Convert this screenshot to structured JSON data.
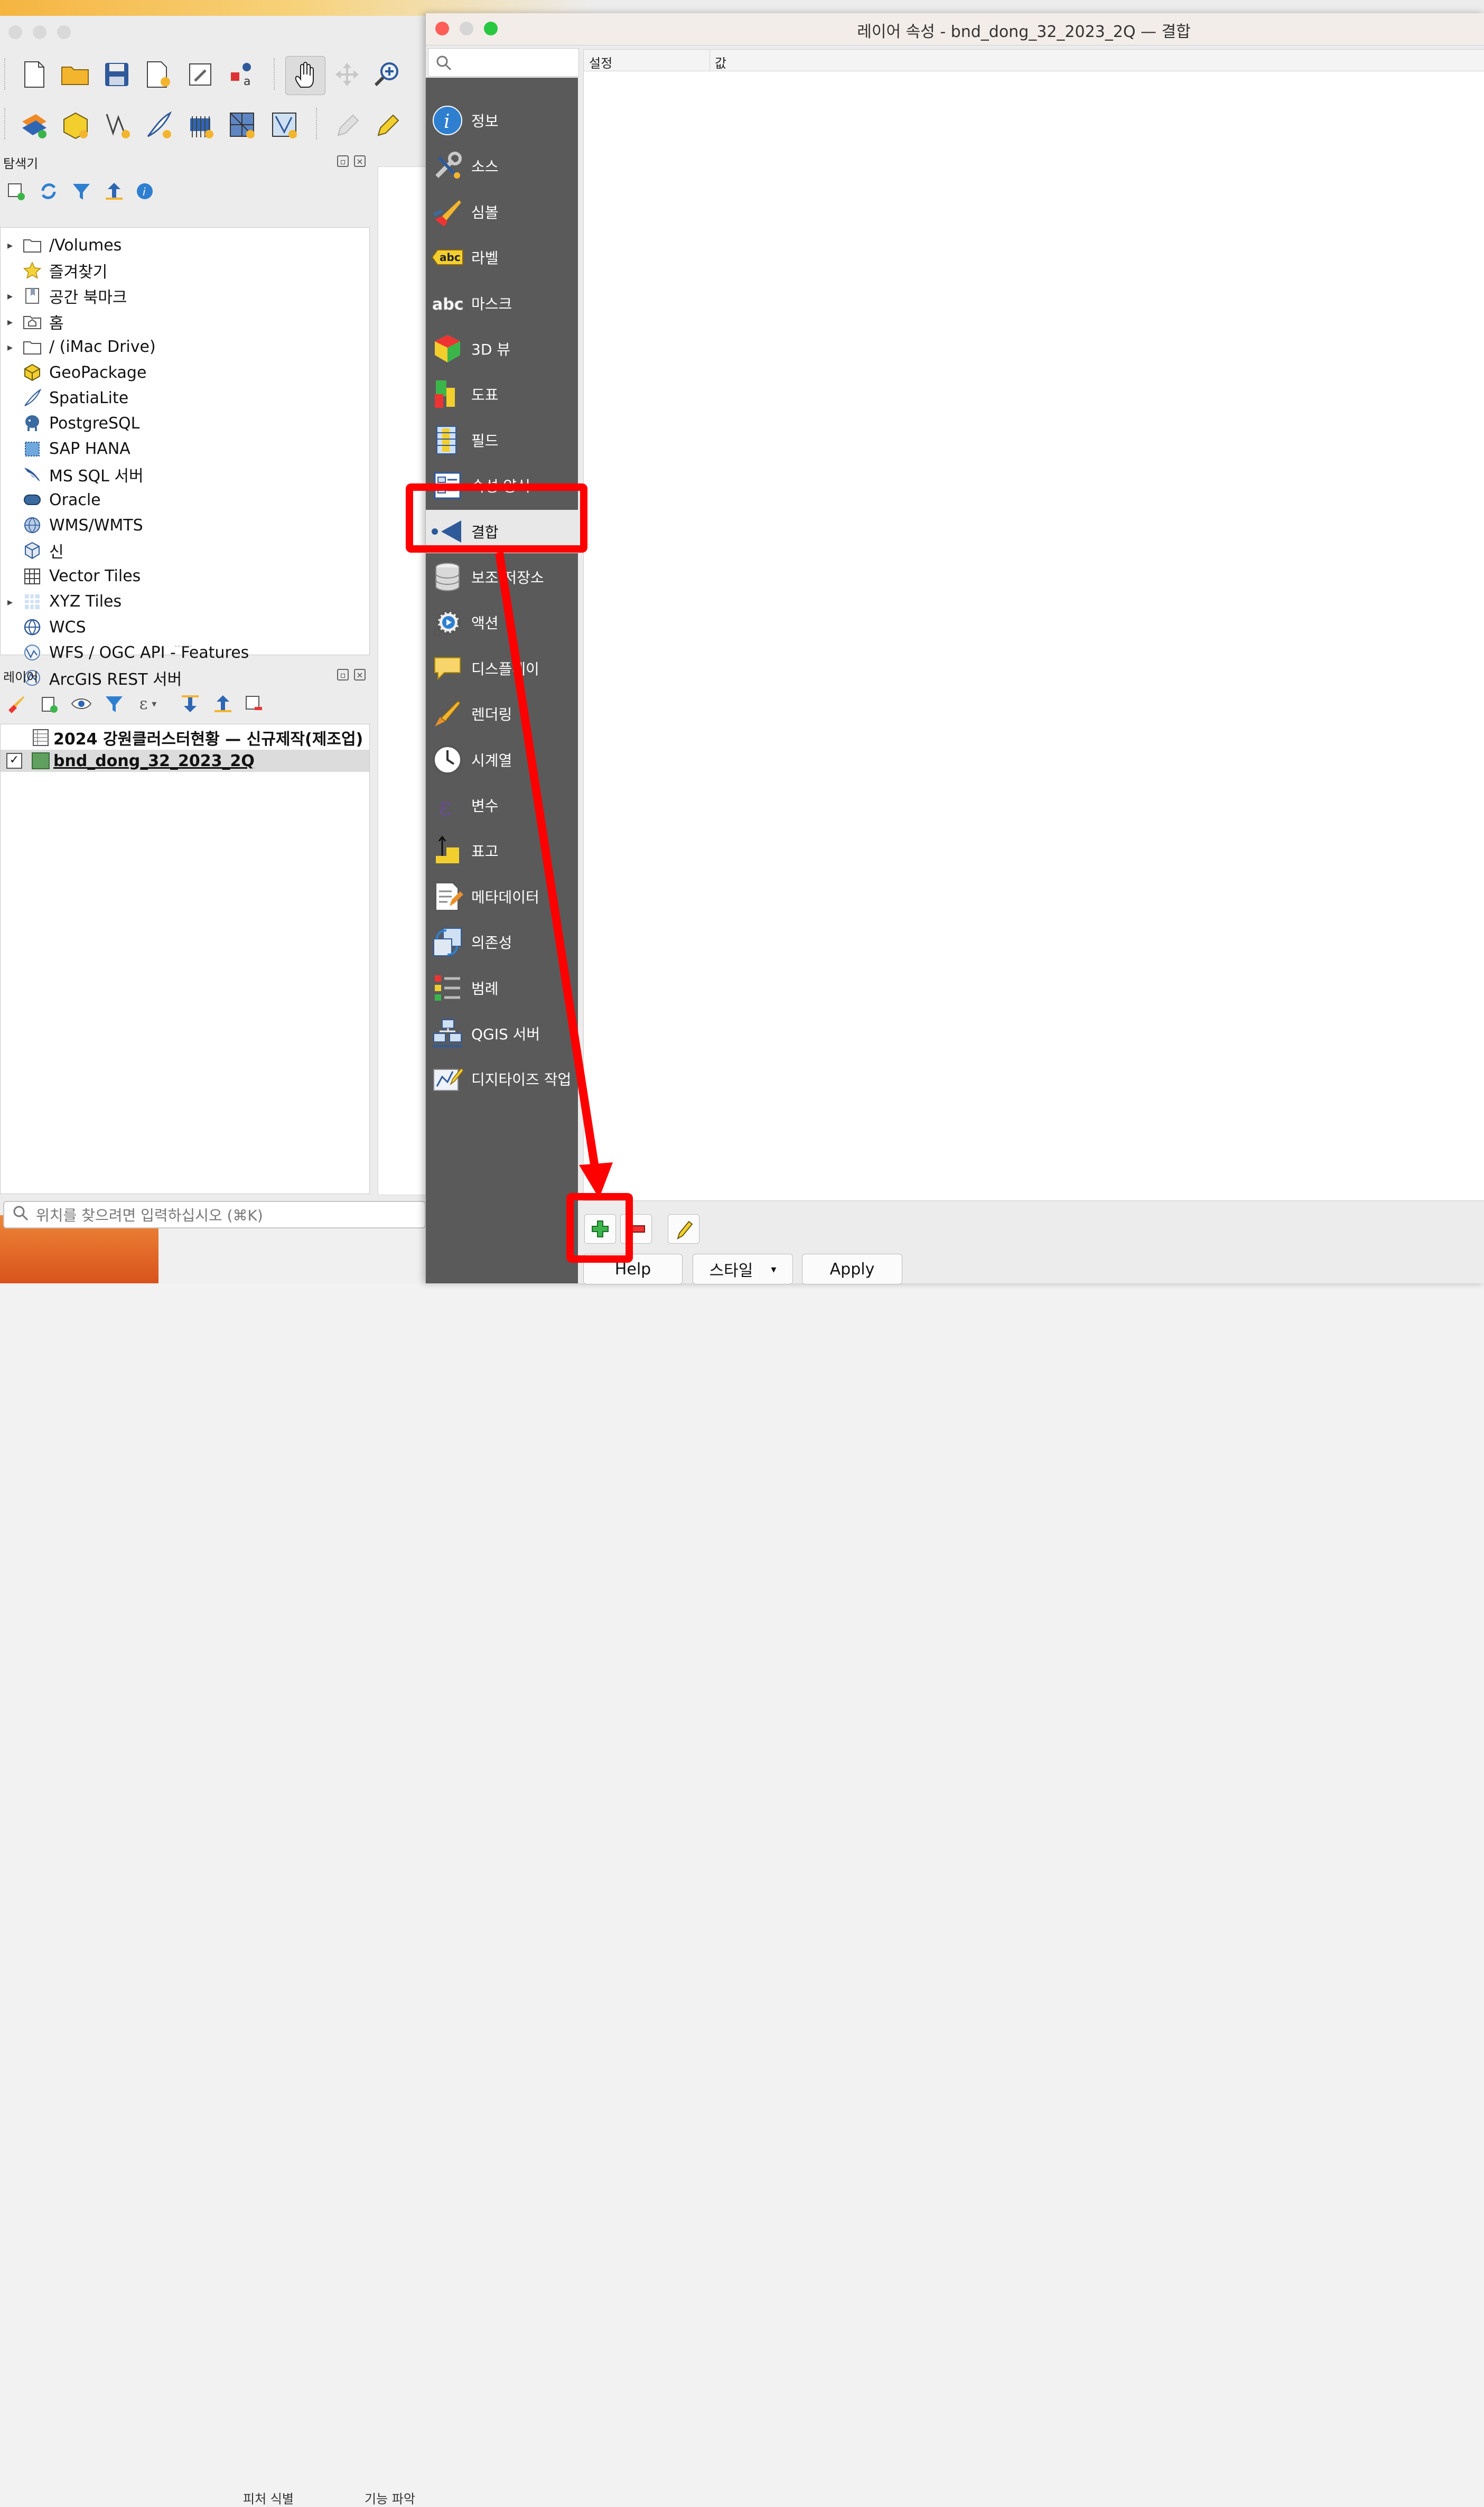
{
  "left_window": {
    "browser_panel_title": "탐색기",
    "browser_items": [
      {
        "label": "/Volumes",
        "icon": "folder-icon",
        "expandable": true
      },
      {
        "label": "즐겨찾기",
        "icon": "star-icon",
        "expandable": false
      },
      {
        "label": "공간 북마크",
        "icon": "bookmark-icon",
        "expandable": true
      },
      {
        "label": "홈",
        "icon": "home-folder-icon",
        "expandable": true
      },
      {
        "label": "/ (iMac Drive)",
        "icon": "folder-icon",
        "expandable": true
      },
      {
        "label": "GeoPackage",
        "icon": "geopackage-icon",
        "expandable": false
      },
      {
        "label": "SpatiaLite",
        "icon": "spatialite-icon",
        "expandable": false
      },
      {
        "label": "PostgreSQL",
        "icon": "postgresql-icon",
        "expandable": false
      },
      {
        "label": "SAP HANA",
        "icon": "sap-hana-icon",
        "expandable": false
      },
      {
        "label": "MS SQL 서버",
        "icon": "mssql-icon",
        "expandable": false
      },
      {
        "label": "Oracle",
        "icon": "oracle-icon",
        "expandable": false
      },
      {
        "label": "WMS/WMTS",
        "icon": "wms-globe-icon",
        "expandable": false
      },
      {
        "label": "신",
        "icon": "scene-cube-icon",
        "expandable": false
      },
      {
        "label": "Vector Tiles",
        "icon": "vector-tiles-icon",
        "expandable": false
      },
      {
        "label": "XYZ Tiles",
        "icon": "xyz-tiles-icon",
        "expandable": true
      },
      {
        "label": "WCS",
        "icon": "wcs-globe-icon",
        "expandable": false
      },
      {
        "label": "WFS / OGC API - Features",
        "icon": "wfs-globe-icon",
        "expandable": false
      },
      {
        "label": "ArcGIS REST 서버",
        "icon": "arcgis-globe-icon",
        "expandable": false
      }
    ],
    "layers_panel_title": "레이어",
    "layers": [
      {
        "label": "2024 강원클러스터현황 — 신규제작(제조업)",
        "type": "table",
        "checked": null
      },
      {
        "label": "bnd_dong_32_2023_2Q",
        "type": "polygon",
        "checked": true,
        "checkmark": "✓"
      }
    ],
    "locator_placeholder": "위치를 찾으려면 입력하십시오 (⌘K)"
  },
  "dialog": {
    "title": "레이어 속성 - bnd_dong_32_2023_2Q — 결합",
    "table_headers": {
      "setting": "설정",
      "value": "값"
    },
    "sidebar_items": [
      {
        "label": "정보",
        "icon": "info-icon"
      },
      {
        "label": "소스",
        "icon": "source-tools-icon"
      },
      {
        "label": "심볼",
        "icon": "symbology-brush-icon"
      },
      {
        "label": "라벨",
        "icon": "labels-abc-icon"
      },
      {
        "label": "마스크",
        "icon": "mask-abc-icon"
      },
      {
        "label": "3D 뷰",
        "icon": "3d-cube-icon"
      },
      {
        "label": "도표",
        "icon": "diagram-icon"
      },
      {
        "label": "필드",
        "icon": "fields-icon"
      },
      {
        "label": "속성 양식",
        "icon": "attributes-form-icon"
      },
      {
        "label": "결합",
        "icon": "joins-icon",
        "selected": true
      },
      {
        "label": "보조 저장소",
        "icon": "auxiliary-storage-icon"
      },
      {
        "label": "액션",
        "icon": "actions-gear-icon"
      },
      {
        "label": "디스플레이",
        "icon": "display-bubble-icon"
      },
      {
        "label": "렌더링",
        "icon": "rendering-brush-icon"
      },
      {
        "label": "시계열",
        "icon": "temporal-clock-icon"
      },
      {
        "label": "변수",
        "icon": "variables-epsilon-icon"
      },
      {
        "label": "표고",
        "icon": "elevation-icon"
      },
      {
        "label": "메타데이터",
        "icon": "metadata-icon"
      },
      {
        "label": "의존성",
        "icon": "dependencies-icon"
      },
      {
        "label": "범례",
        "icon": "legend-icon"
      },
      {
        "label": "QGIS 서버",
        "icon": "qgis-server-icon"
      },
      {
        "label": "디지타이즈 작업",
        "icon": "digitizing-icon"
      }
    ],
    "buttons": {
      "help": "Help",
      "style": "스타일",
      "style_arrow": "▾",
      "apply": "Apply"
    }
  },
  "background": {
    "tab_text_1": "피처 식별",
    "tab_text_2": "기능 파악"
  },
  "colors": {
    "annotation_red": "#ff0000",
    "sidebar_bg": "#5a5a5a",
    "close": "#ff5f57",
    "minimize": "#febc2e",
    "zoom": "#28c840"
  }
}
